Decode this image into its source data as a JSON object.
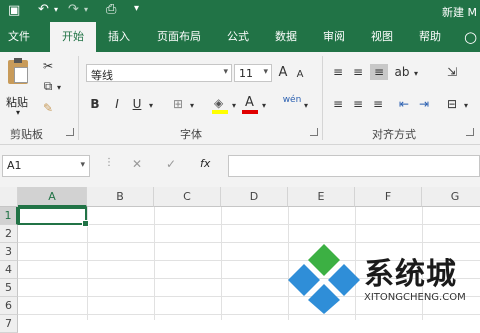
{
  "title_bar": {
    "doc_title": "新建 M"
  },
  "tabs": [
    {
      "label": "文件",
      "active": false
    },
    {
      "label": "开始",
      "active": true
    },
    {
      "label": "插入",
      "active": false
    },
    {
      "label": "页面布局",
      "active": false
    },
    {
      "label": "公式",
      "active": false
    },
    {
      "label": "数据",
      "active": false
    },
    {
      "label": "审阅",
      "active": false
    },
    {
      "label": "视图",
      "active": false
    },
    {
      "label": "帮助",
      "active": false
    }
  ],
  "ribbon": {
    "clipboard": {
      "paste_label": "粘贴",
      "group_label": "剪贴板"
    },
    "font": {
      "font_name": "等线",
      "font_size": "11",
      "grow": "A",
      "shrink": "A",
      "bold": "B",
      "italic": "I",
      "underline": "U",
      "wen": "wén",
      "group_label": "字体"
    },
    "alignment": {
      "group_label": "对齐方式"
    }
  },
  "formula_bar": {
    "cell_ref": "A1",
    "fx": "fx",
    "cancel": "✕",
    "enter": "✓",
    "content": ""
  },
  "grid": {
    "columns": [
      "A",
      "B",
      "C",
      "D",
      "E",
      "F",
      "G"
    ],
    "rows": [
      "1",
      "2",
      "3",
      "4",
      "5",
      "6",
      "7"
    ]
  },
  "watermark": {
    "text": "系统城",
    "subtext": "XITONGCHENG.COM"
  },
  "colors": {
    "accent": "#217346",
    "ribbon_bg": "#f3f3f3"
  }
}
